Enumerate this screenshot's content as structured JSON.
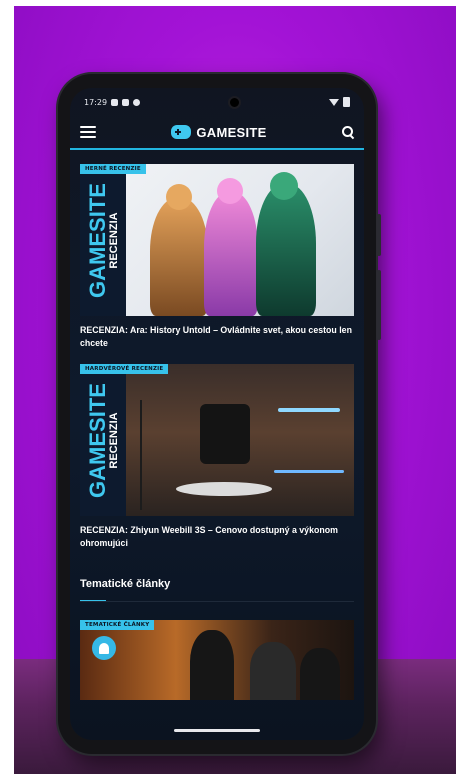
{
  "status_bar": {
    "time": "17:29"
  },
  "header": {
    "logo_text": "GAMESITE"
  },
  "feed": {
    "articles": [
      {
        "category": "HERNÉ RECENZIE",
        "brand": "GAMESITE",
        "brand_sub": "RECENZIA",
        "title": "RECENZIA: Ara: History Untold – Ovládnite svet, akou cestou len chcete"
      },
      {
        "category": "HARDVÉROVÉ RECENZIE",
        "brand": "GAMESITE",
        "brand_sub": "RECENZIA",
        "title": "RECENZIA: Zhiyun Weebill 3S – Cenovo dostupný a výkonom ohromujúci"
      }
    ],
    "section": {
      "title": "Tematické články",
      "first_card_category": "TEMATICKÉ ČLÁNKY"
    }
  },
  "colors": {
    "accent": "#37c2ea",
    "background": "#101521",
    "backdrop": "#a313d6"
  }
}
